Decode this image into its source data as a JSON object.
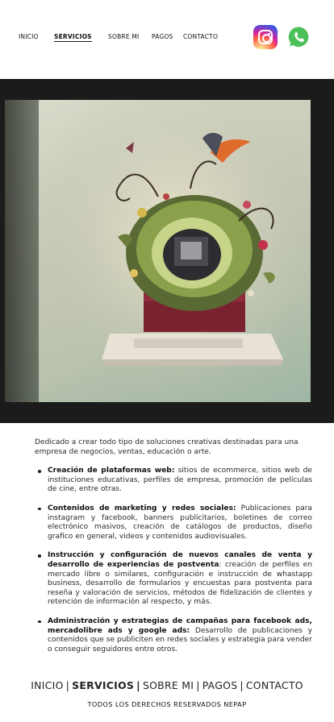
{
  "nav": {
    "items": [
      {
        "label": "INICIO",
        "active": false
      },
      {
        "label": "SERVICIOS",
        "active": true
      },
      {
        "label": "SOBRE MI",
        "active": false
      },
      {
        "label": "PAGOS",
        "active": false
      },
      {
        "label": "CONTACTO",
        "active": false
      }
    ],
    "icons": [
      "instagram-icon",
      "whatsapp-icon"
    ]
  },
  "colors": {
    "hero_background": "#1b1b1b",
    "whatsapp_green": "#4bc058",
    "laptop_red": "#8f2b3a"
  },
  "content": {
    "intro": "Dedicado a crear todo tipo de soluciones creativas destinadas para una empresa de negocios, ventas, educación o arte.",
    "services": [
      {
        "title": "Creación de plataformas web:",
        "text": " sitios de ecommerce, sitios web de instituciones educativas, perfiles de empresa, promoción de películas de cine, entre otras."
      },
      {
        "title": "Contenidos de marketing y redes sociales:",
        "text": " Publicaciones para instagram y facebook, banners publicitarios, boletines de correo electrónico masivos, creación de catálogos de productos, diseño grafico en general, videos y contenidos audiovisuales."
      },
      {
        "title": "Instrucción y configuración de nuevos canales de venta y desarrollo de experiencias de postventa",
        "text": ": creación de perfiles en mercado libre o similares, configuración e instrucción de whastapp business, desarrollo de formularios y encuestas para postventa para reseña y valoración de servicios, métodos de fidelización de clientes y retención de información al respecto, y más."
      },
      {
        "title": "Administración y estrategias de campañas para facebook ads, mercadolibre ads y google ads:",
        "text": " Desarrollo de publicaciones y contenidos que se publiciten en redes sociales y estrategia para vender o conseguir seguidores entre otros."
      }
    ]
  },
  "footer": {
    "items": [
      {
        "label": "INICIO",
        "active": false
      },
      {
        "label": "SERVICIOS",
        "active": true
      },
      {
        "label": "SOBRE MI",
        "active": false
      },
      {
        "label": "PAGOS",
        "active": false
      },
      {
        "label": "CONTACTO",
        "active": false
      }
    ],
    "separator": "|",
    "copyright": "TODOS LOS DERECHOS RESERVADOS  NEPAP"
  }
}
